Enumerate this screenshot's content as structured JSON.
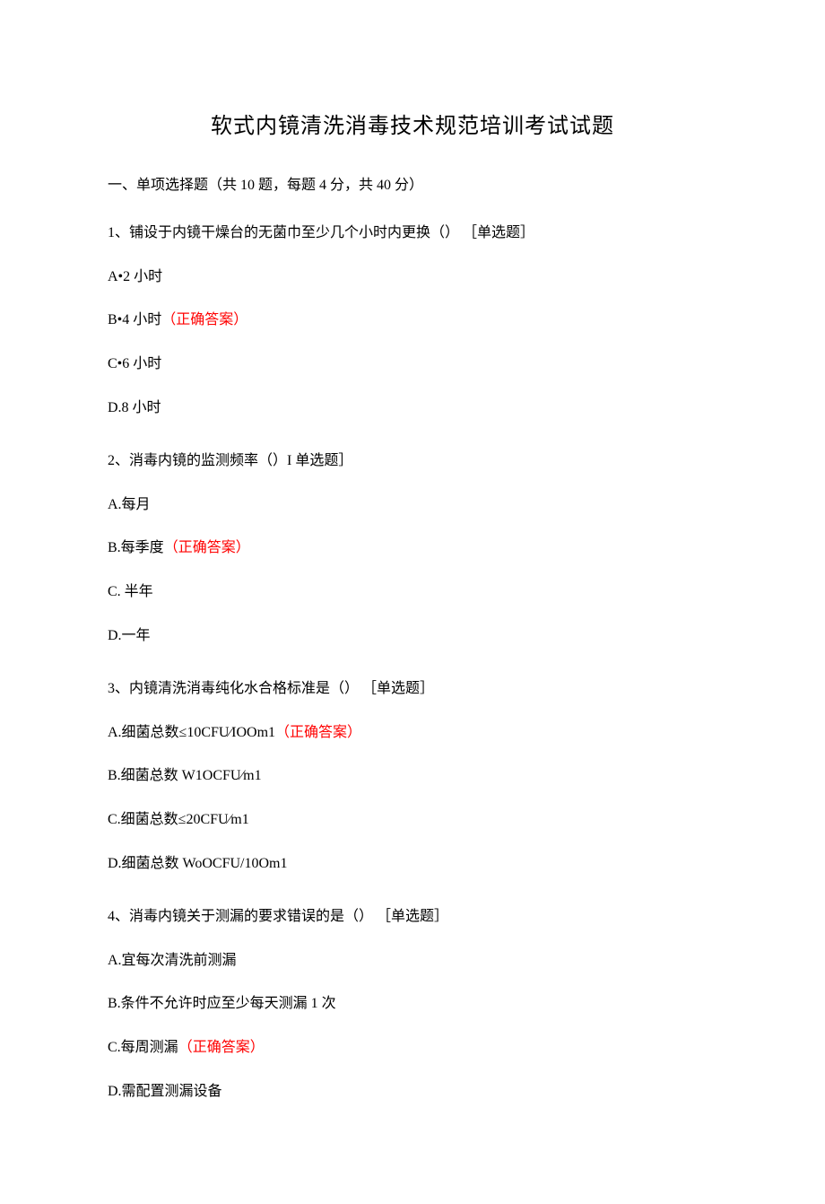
{
  "title": "软式内镜清洗消毒技术规范培训考试试题",
  "section_header": "一、单项选择题（共 10 题，每题 4 分，共 40 分）",
  "questions": [
    {
      "text": "1、铺设于内镜干燥台的无菌巾至少几个小时内更换（） ［单选题］",
      "options": [
        {
          "label": "A•2 小时",
          "correct": false
        },
        {
          "label": "B•4 小时",
          "correct": true
        },
        {
          "label": "C•6 小时",
          "correct": false
        },
        {
          "label": "D.8 小时",
          "correct": false
        }
      ]
    },
    {
      "text": "2、消毒内镜的监测频率（）I 单选题］",
      "options": [
        {
          "label": "A.每月",
          "correct": false
        },
        {
          "label": "B.每季度",
          "correct": true
        },
        {
          "label": "C. 半年",
          "correct": false
        },
        {
          "label": "D.一年",
          "correct": false
        }
      ]
    },
    {
      "text": "3、内镜清洗消毒纯化水合格标准是（） ［单选题］",
      "options": [
        {
          "label": "A.细菌总数≤10CFU⁄IOOm1",
          "correct": true
        },
        {
          "label": "B.细菌总数 W1OCFU⁄m1",
          "correct": false
        },
        {
          "label": "C.细菌总数≤20CFU⁄m1",
          "correct": false
        },
        {
          "label": "D.细菌总数 WoOCFU/10Om1",
          "correct": false
        }
      ]
    },
    {
      "text": "4、消毒内镜关于测漏的要求错误的是（） ［单选题］",
      "options": [
        {
          "label": "A.宜每次清洗前测漏",
          "correct": false
        },
        {
          "label": "B.条件不允许时应至少每天测漏 1 次",
          "correct": false
        },
        {
          "label": "C.每周测漏",
          "correct": true
        },
        {
          "label": "D.需配置测漏设备",
          "correct": false
        }
      ]
    }
  ],
  "correct_marker": "（正确答案）"
}
